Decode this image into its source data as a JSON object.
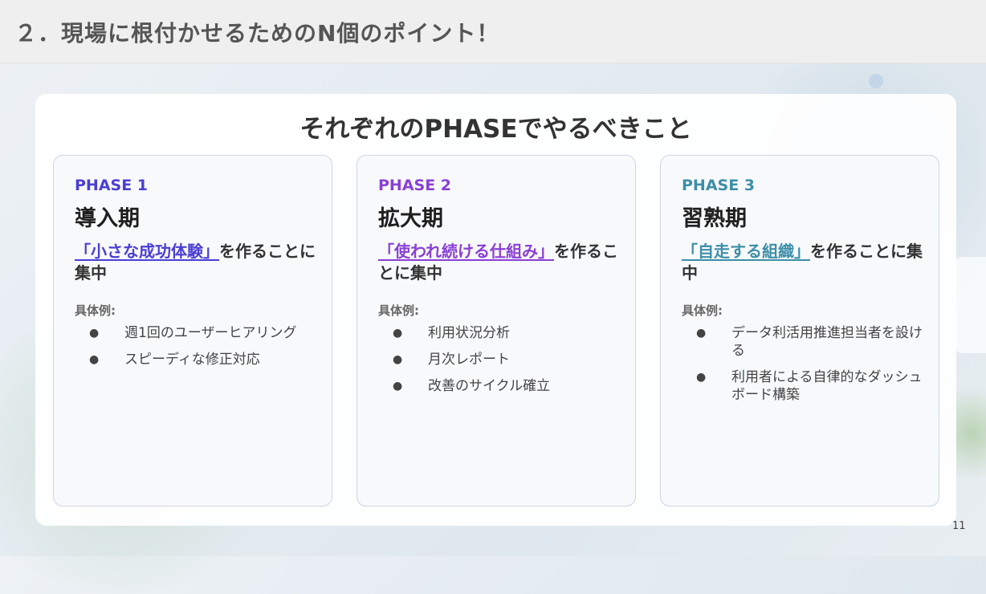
{
  "header": {
    "title": "２．現場に根付かせるためのN個のポイント！"
  },
  "panel": {
    "title": "それぞれのPHASEでやるべきこと"
  },
  "examples_label": "具体例:",
  "phases": [
    {
      "label": "PHASE 1",
      "label_color": "#4a3fd6",
      "name": "導入期",
      "focus_highlight": "「小さな成功体験」",
      "focus_rest": "を作ることに集中",
      "highlight_color": "#4a3fd6",
      "examples": [
        "週1回のユーザーヒアリング",
        "スピーディな修正対応"
      ]
    },
    {
      "label": "PHASE 2",
      "label_color": "#8a3fd6",
      "name": "拡大期",
      "focus_highlight": "「使われ続ける仕組み」",
      "focus_rest": "を作ることに集中",
      "highlight_color": "#8a3fd6",
      "examples": [
        "利用状況分析",
        "月次レポート",
        "改善のサイクル確立"
      ]
    },
    {
      "label": "PHASE 3",
      "label_color": "#3c8fa8",
      "name": "習熟期",
      "focus_highlight": "「自走する組織」",
      "focus_rest": "を作ることに集中",
      "highlight_color": "#3c8fa8",
      "examples": [
        "データ利活用推進担当者を設ける",
        "利用者による自律的なダッシュボード構築"
      ]
    }
  ],
  "page_number": "11"
}
